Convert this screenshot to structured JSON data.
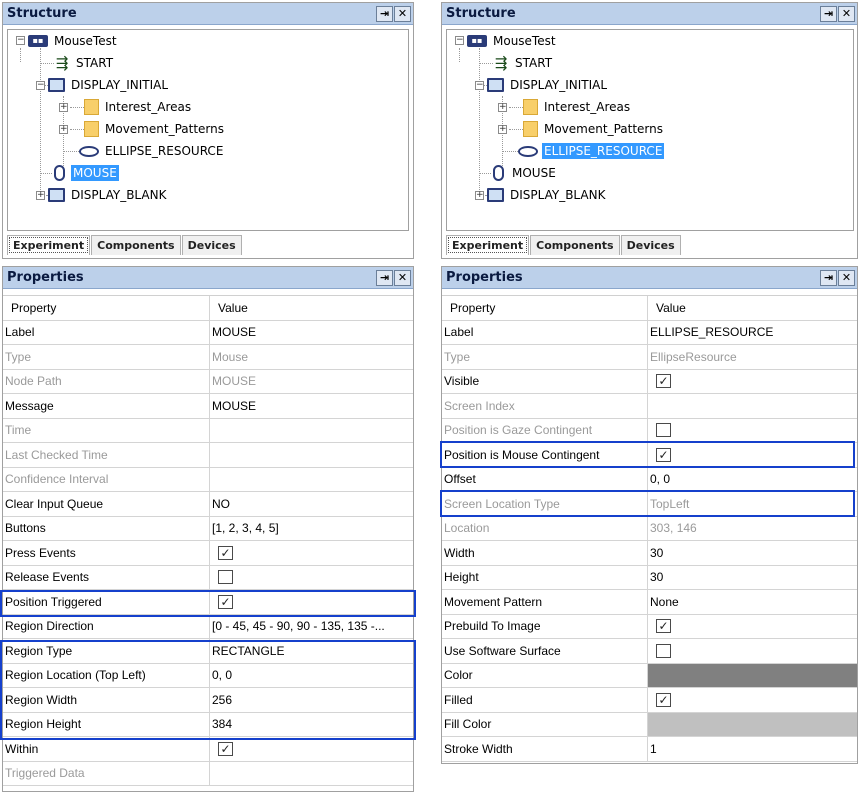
{
  "panels": [
    {
      "structure": {
        "title": "Structure",
        "pin_btn": "⇥",
        "close_btn": "✕",
        "tree": [
          {
            "label": "MouseTest",
            "icon": "experiment-icon",
            "selected": false
          },
          {
            "label": "START",
            "icon": "start-icon",
            "selected": false
          },
          {
            "label": "DISPLAY_INITIAL",
            "icon": "display-icon",
            "selected": false
          },
          {
            "label": "Interest_Areas",
            "icon": "folder-icon",
            "selected": false
          },
          {
            "label": "Movement_Patterns",
            "icon": "folder-icon",
            "selected": false
          },
          {
            "label": "ELLIPSE_RESOURCE",
            "icon": "ellipse-icon",
            "selected": false
          },
          {
            "label": "MOUSE",
            "icon": "mouse-icon",
            "selected": true
          },
          {
            "label": "DISPLAY_BLANK",
            "icon": "display-icon",
            "selected": false
          }
        ],
        "tabs": [
          "Experiment",
          "Components",
          "Devices"
        ]
      },
      "properties": {
        "title": "Properties",
        "pin_btn": "⇥",
        "close_btn": "✕",
        "header": {
          "property": "Property",
          "value": "Value"
        },
        "rows": [
          {
            "name": "Label",
            "value": "MOUSE",
            "gray": false
          },
          {
            "name": "Type",
            "value": "Mouse",
            "gray": true
          },
          {
            "name": "Node Path",
            "value": "MOUSE",
            "gray": true
          },
          {
            "name": "Message",
            "value": "MOUSE",
            "gray": false
          },
          {
            "name": "Time",
            "value": "",
            "gray": true
          },
          {
            "name": "Last Checked Time",
            "value": "",
            "gray": true
          },
          {
            "name": "Confidence Interval",
            "value": "",
            "gray": true
          },
          {
            "name": "Clear Input Queue",
            "value": "NO",
            "gray": false
          },
          {
            "name": "Buttons",
            "value": "[1, 2, 3, 4, 5]",
            "gray": false
          },
          {
            "name": "Press Events",
            "value": "",
            "checked": true,
            "gray": false
          },
          {
            "name": "Release Events",
            "value": "",
            "checked": false,
            "gray": false
          },
          {
            "name": "Position Triggered",
            "value": "",
            "checked": true,
            "gray": false
          },
          {
            "name": "Region Direction",
            "value": "[0 - 45, 45 - 90, 90 - 135, 135 -...",
            "gray": false
          },
          {
            "name": "Region Type",
            "value": "RECTANGLE",
            "gray": false
          },
          {
            "name": "Region Location (Top Left)",
            "value": "0, 0",
            "gray": false
          },
          {
            "name": "Region Width",
            "value": "256",
            "gray": false
          },
          {
            "name": "Region Height",
            "value": "384",
            "gray": false
          },
          {
            "name": "Within",
            "value": "",
            "checked": true,
            "gray": false
          },
          {
            "name": "Triggered Data",
            "value": "",
            "gray": true
          }
        ]
      }
    },
    {
      "structure": {
        "title": "Structure",
        "pin_btn": "⇥",
        "close_btn": "✕",
        "tree": [
          {
            "label": "MouseTest",
            "icon": "experiment-icon",
            "selected": false
          },
          {
            "label": "START",
            "icon": "start-icon",
            "selected": false
          },
          {
            "label": "DISPLAY_INITIAL",
            "icon": "display-icon",
            "selected": false
          },
          {
            "label": "Interest_Areas",
            "icon": "folder-icon",
            "selected": false
          },
          {
            "label": "Movement_Patterns",
            "icon": "folder-icon",
            "selected": false
          },
          {
            "label": "ELLIPSE_RESOURCE",
            "icon": "ellipse-icon",
            "selected": true
          },
          {
            "label": "MOUSE",
            "icon": "mouse-icon",
            "selected": false
          },
          {
            "label": "DISPLAY_BLANK",
            "icon": "display-icon",
            "selected": false
          }
        ],
        "tabs": [
          "Experiment",
          "Components",
          "Devices"
        ]
      },
      "properties": {
        "title": "Properties",
        "pin_btn": "⇥",
        "close_btn": "✕",
        "header": {
          "property": "Property",
          "value": "Value"
        },
        "rows": [
          {
            "name": "Label",
            "value": "ELLIPSE_RESOURCE",
            "gray": false
          },
          {
            "name": "Type",
            "value": "EllipseResource",
            "gray": true
          },
          {
            "name": "Visible",
            "value": "",
            "checked": true,
            "gray": false
          },
          {
            "name": "Screen Index",
            "value": "",
            "gray": true
          },
          {
            "name": "Position is Gaze Contingent",
            "value": "",
            "checked": false,
            "gray": true
          },
          {
            "name": "Position is Mouse Contingent",
            "value": "",
            "checked": true,
            "gray": false
          },
          {
            "name": "Offset",
            "value": "0, 0",
            "gray": false
          },
          {
            "name": "Screen Location Type",
            "value": "TopLeft",
            "gray": true
          },
          {
            "name": "Location",
            "value": "303, 146",
            "gray": true
          },
          {
            "name": "Width",
            "value": "30",
            "gray": false
          },
          {
            "name": "Height",
            "value": "30",
            "gray": false
          },
          {
            "name": "Movement Pattern",
            "value": "None",
            "gray": false
          },
          {
            "name": "Prebuild To Image",
            "value": "",
            "checked": true,
            "gray": false
          },
          {
            "name": "Use Software Surface",
            "value": "",
            "checked": false,
            "gray": false
          },
          {
            "name": "Color",
            "value": "",
            "swatch": "#808080",
            "gray": false
          },
          {
            "name": "Filled",
            "value": "",
            "checked": true,
            "gray": false
          },
          {
            "name": "Fill Color",
            "value": "",
            "swatch": "#c0c0c0",
            "gray": false
          },
          {
            "name": "Stroke Width",
            "value": "1",
            "gray": false
          }
        ]
      }
    }
  ],
  "colors": {
    "highlight": "#1540cc",
    "selection": "#3399ff",
    "titlebar": "#bcd0ea"
  }
}
